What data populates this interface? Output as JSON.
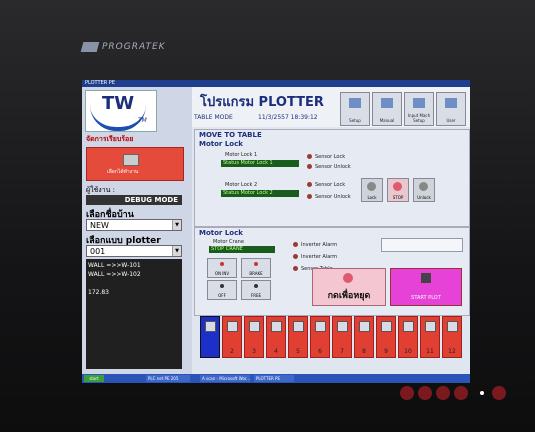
{
  "bezel": {
    "brand": "PROGRATEK"
  },
  "window": {
    "title": "PLOTTER PE"
  },
  "left": {
    "section_title": "จัดการเรียบร้อย",
    "red_button_label": "เลือกได้ทำงาน",
    "user_label": "ผู้ใช้งาน :",
    "user_value": "DEBUG MODE",
    "house_label": "เลือกชื่อบ้าน",
    "house_value": "NEW",
    "plotter_label": "เลือกแบบ plotter",
    "plotter_value": "001",
    "list_lines": [
      "WALL  =>>W-101",
      "WALL  =>>W-102",
      "",
      "172.83"
    ]
  },
  "header": {
    "logo_text": "TW",
    "logo_tm": "TM",
    "program_title": "โปรแกรม PLOTTER",
    "mode": "TABLE MODE",
    "datetime": "11/3/2557 18:39:12",
    "buttons": [
      "Setup",
      "Manual",
      "Input Mach Setup",
      "User"
    ]
  },
  "move_to_table": {
    "title": "MOVE TO TABLE",
    "subtitle": "Motor Lock",
    "motor_lock_1_label": "Motor Lock 1",
    "motor_lock_1_status": "Status Motor Lock 1",
    "motor_lock_2_label": "Motor Lock 2",
    "motor_lock_2_status": "Status Motor Lock 2",
    "sensor_lock_1": "Sensor Lock",
    "sensor_unlock_1": "Sensor Unlock",
    "sensor_lock_2": "Sensor Lock",
    "sensor_unlock_2": "Sensor Unlock",
    "actions": [
      "Lock",
      "STOP",
      "Unlock"
    ]
  },
  "motor_crane": {
    "title": "Motor Lock",
    "crane_label": "Motor Crane",
    "crane_status": "STOP CRANE",
    "inverter_alarm_1": "Inverter Alarm",
    "inverter_alarm_2": "Inverter Alarm",
    "sensor_table": "Sensor Table",
    "controls": [
      "ON INV",
      "BRAKE",
      "OFF",
      "FREE"
    ],
    "pink_button": "กดเพื่อหยุด",
    "magenta_button": "START PLOT"
  },
  "tables": [
    "",
    "2",
    "3",
    "4",
    "5",
    "6",
    "7",
    "8",
    "9",
    "10",
    "11",
    "12"
  ],
  "taskbar": {
    "start": "start",
    "items": [
      "PLC net PE 205",
      "A scan - Microsoft Wor...",
      "PLOTTER PE"
    ]
  }
}
